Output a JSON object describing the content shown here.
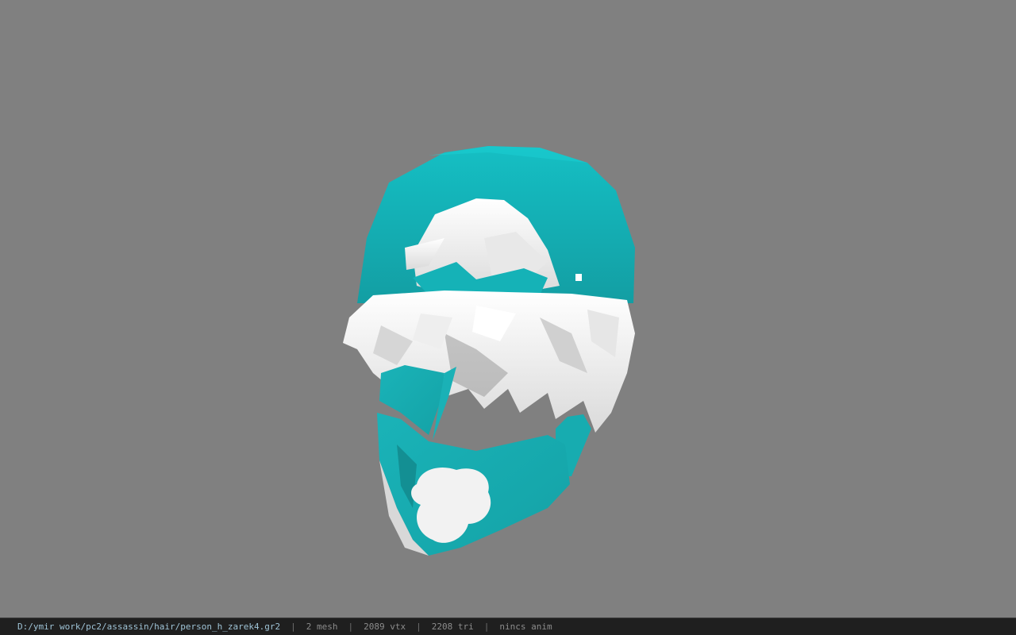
{
  "viewport": {
    "background": "#808080",
    "model": {
      "kind": "3d-model-render",
      "accent": "#1fb3b8",
      "hair": "#f0f0f0"
    }
  },
  "statusbar": {
    "file_path": "D:/ymir work/pc2/assassin/hair/person_h_zarek4.gr2",
    "separator": "|",
    "mesh_count": "2 mesh",
    "vertex_count": "2089 vtx",
    "triangle_count": "2208 tri",
    "anim_status": "nincs anim"
  }
}
